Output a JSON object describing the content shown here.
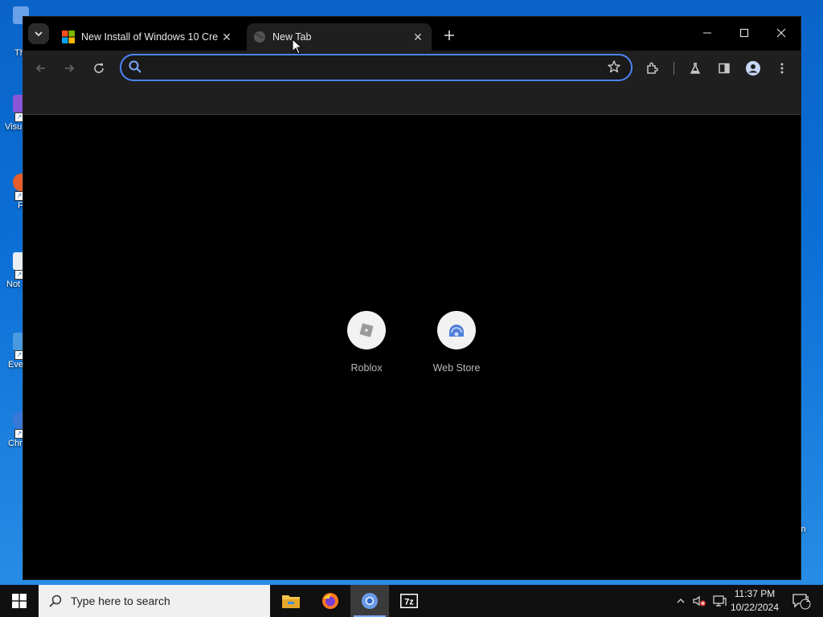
{
  "desktop": {
    "icons": [
      {
        "label": "Th",
        "color": "#6aa0e8"
      },
      {
        "label": "Visu",
        "color": "#8a56d8"
      },
      {
        "label": "F",
        "color": "#e85d2a"
      },
      {
        "label": "Not",
        "color": "#6bbf59"
      },
      {
        "label": "Eve",
        "color": "#4a9ae0"
      },
      {
        "label": "Chr",
        "color": "#3a78d8"
      }
    ],
    "right_label": "in"
  },
  "browser": {
    "tabs": [
      {
        "title": "New Install of Windows 10 Cre",
        "active": false,
        "icon": "windows-logo-icon"
      },
      {
        "title": "New Tab",
        "active": true,
        "icon": "globe-icon"
      }
    ],
    "omnibox": {
      "value": "",
      "placeholder": ""
    },
    "shortcuts": [
      {
        "label": "Roblox",
        "icon": "roblox-icon"
      },
      {
        "label": "Web Store",
        "icon": "web-store-icon"
      }
    ]
  },
  "taskbar": {
    "search_placeholder": "Type here to search",
    "apps": [
      {
        "name": "file-explorer-icon",
        "active": false
      },
      {
        "name": "firefox-icon",
        "active": false
      },
      {
        "name": "chromium-icon",
        "active": true
      },
      {
        "name": "7zip-icon",
        "active": false
      }
    ],
    "time": "11:37 PM",
    "date": "10/22/2024",
    "notification_count": "1",
    "accent": "#7aa7ff"
  }
}
